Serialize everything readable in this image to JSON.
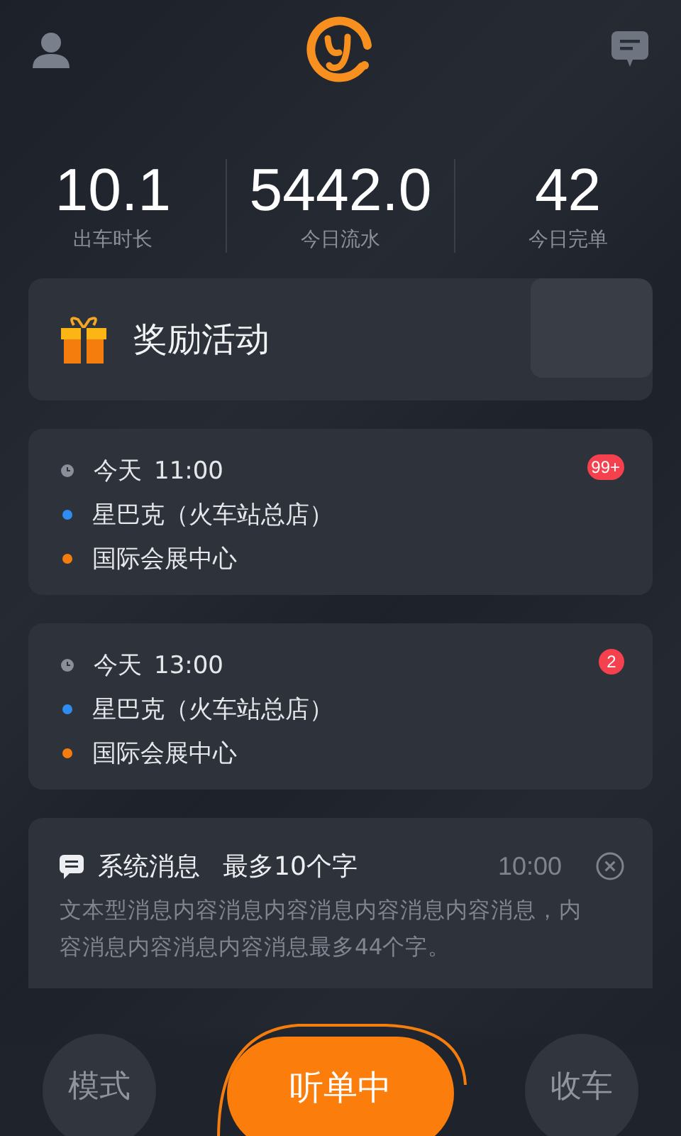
{
  "stats": [
    {
      "value": "10.1",
      "label": "出车时长"
    },
    {
      "value": "5442.0",
      "label": "今日流水"
    },
    {
      "value": "42",
      "label": "今日完单"
    }
  ],
  "reward": {
    "title": "奖励活动"
  },
  "orders": [
    {
      "day": "今天",
      "time": "11:00",
      "from": "星巴克（火车站总店）",
      "to": "国际会展中心",
      "badge": "99+"
    },
    {
      "day": "今天",
      "time": "13:00",
      "from": "星巴克（火车站总店）",
      "to": "国际会展中心",
      "badge": "2"
    }
  ],
  "message": {
    "title": "系统消息",
    "subtitle": "最多10个字",
    "time": "10:00",
    "body": "文本型消息内容消息内容消息内容消息内容消息，内容消息内容消息内容消息最多44个字。"
  },
  "bottom": {
    "left": "模式",
    "main": "听单中",
    "right": "收车"
  }
}
